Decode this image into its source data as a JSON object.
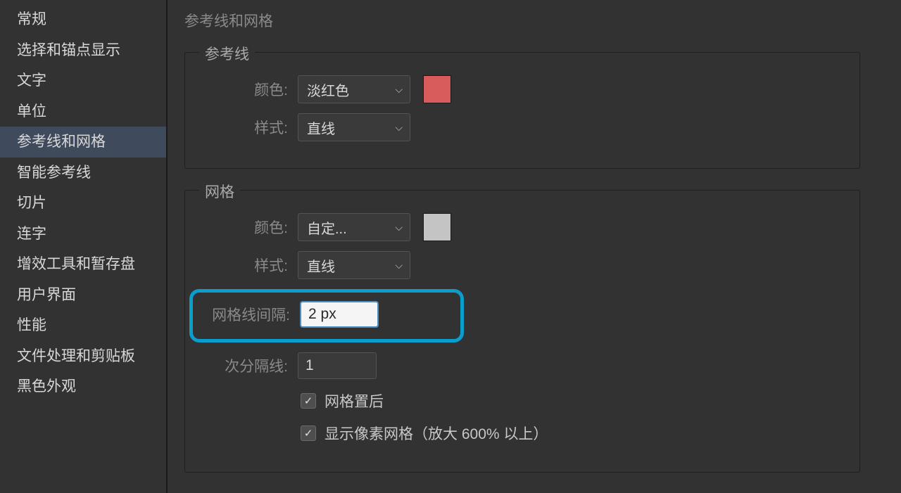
{
  "sidebar": {
    "items": [
      {
        "label": "常规"
      },
      {
        "label": "选择和锚点显示"
      },
      {
        "label": "文字"
      },
      {
        "label": "单位"
      },
      {
        "label": "参考线和网格",
        "selected": true
      },
      {
        "label": "智能参考线"
      },
      {
        "label": "切片"
      },
      {
        "label": "连字"
      },
      {
        "label": "增效工具和暂存盘"
      },
      {
        "label": "用户界面"
      },
      {
        "label": "性能"
      },
      {
        "label": "文件处理和剪贴板"
      },
      {
        "label": "黑色外观"
      }
    ]
  },
  "main": {
    "title": "参考线和网格"
  },
  "guides": {
    "legend": "参考线",
    "color_label": "颜色:",
    "color_value": "淡红色",
    "color_swatch": "#d85c5c",
    "style_label": "样式:",
    "style_value": "直线"
  },
  "grid": {
    "legend": "网格",
    "color_label": "颜色:",
    "color_value": "自定...",
    "color_swatch": "#c4c4c4",
    "style_label": "样式:",
    "style_value": "直线",
    "spacing_label": "网格线间隔:",
    "spacing_value": "2 px",
    "subdiv_label": "次分隔线:",
    "subdiv_value": "1",
    "grid_back_label": "网格置后",
    "grid_back_checked": true,
    "pixel_grid_label": "显示像素网格（放大 600% 以上）",
    "pixel_grid_checked": true
  }
}
